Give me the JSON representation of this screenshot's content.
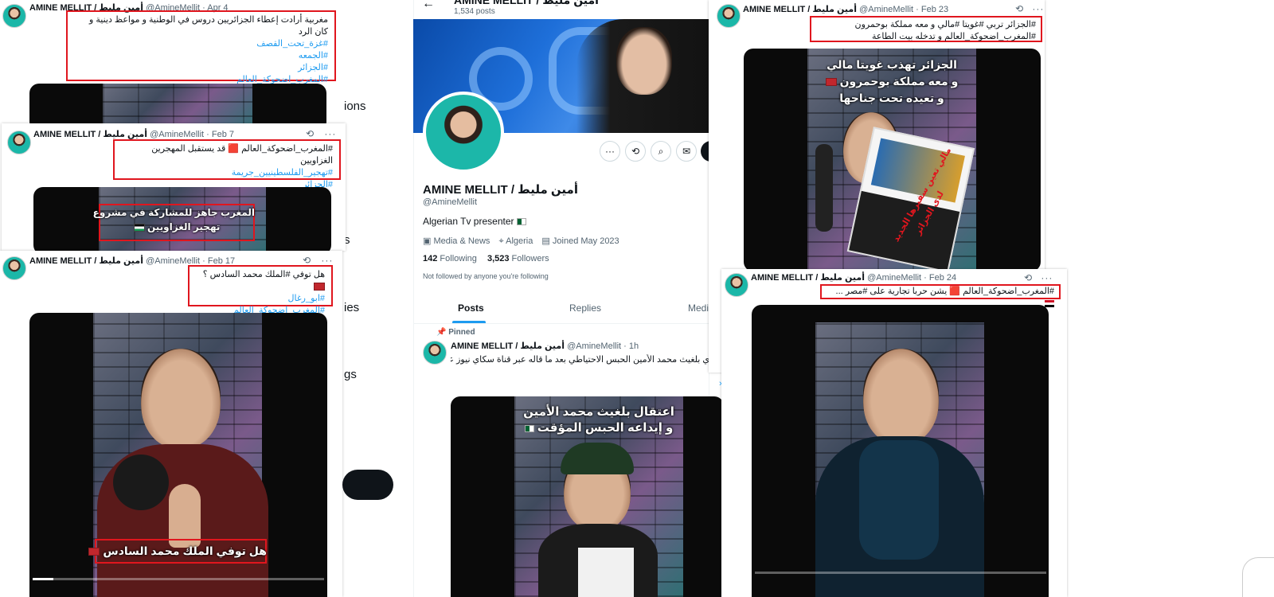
{
  "colors": {
    "accent": "#1d9bf0",
    "highlight": "#e0161e",
    "text": "#0f1419",
    "muted": "#536471"
  },
  "behind": {
    "fragments": [
      "ions",
      "s",
      "ies",
      "gs"
    ]
  },
  "profile": {
    "header_name": "AMINE MELLIT / أمين مليط",
    "posts_count": "1,534 posts",
    "display_name": "AMINE MELLIT / أمين مليط",
    "handle": "@AmineMellit",
    "bio": "Algerian Tv presenter",
    "category": "Media & News",
    "location": "Algeria",
    "joined": "Joined May 2023",
    "following_count": "142",
    "following_label": "Following",
    "followers_count": "3,523",
    "followers_label": "Followers",
    "not_followed_note": "Not followed by anyone you're following",
    "tabs": [
      "Posts",
      "Replies",
      "Medi"
    ],
    "pinned_label": "Pinned",
    "pinned_post": {
      "name": "AMINE MELLIT / أمين مليط",
      "meta": "@AmineMellit · 1h",
      "text": "ي بلغيث محمد الأمين الحبس الاحتياطي بعد ما قاله عبر قناة سكاي نيوز عربية",
      "video_overlay_line1": "اعتقال بلغيث محمد الأمين",
      "video_overlay_line2": "و إيداعه الحبس المؤقت"
    }
  },
  "posts": [
    {
      "name": "AMINE MELLIT / أمين مليط",
      "meta": "@AmineMellit · Apr 4",
      "lines": [
        {
          "text": "مغربية أرادت إعطاء الجزائريين دروس في الوطنية و مواعظ دينية و كان الرد",
          "tag": false
        },
        {
          "text": "#غزة_تحت_القصف",
          "tag": true
        },
        {
          "text": "#الجمعه",
          "tag": true
        },
        {
          "text": "#الجزائر",
          "tag": true
        },
        {
          "text": "#المغرب_اضحوكة_العالم",
          "tag": true
        }
      ]
    },
    {
      "name": "AMINE MELLIT / أمين مليط",
      "meta": "@AmineMellit · Feb 7",
      "lines": [
        {
          "text": "#المغرب_اضحوكة_العالم 🟥 قد يستقبل المهجرين الغزاويين",
          "tag": false
        },
        {
          "text": "#تهجير_الفلسطينيين_جريمة",
          "tag": true
        },
        {
          "text": "#الجزائر",
          "tag": true
        }
      ],
      "overlay_line1": "المغرب جاهز للمشاركة في مشروع",
      "overlay_line2": "تهجير الغزاويين"
    },
    {
      "name": "AMINE MELLIT / أمين مليط",
      "meta": "@AmineMellit · Feb 17",
      "lines": [
        {
          "text": "هل توفي #الملك محمد السادس ؟",
          "tag": false
        },
        {
          "text": "#ابو_رغال",
          "tag": true
        },
        {
          "text": "#المغرب_اضحوكة_العالم",
          "tag": true
        }
      ],
      "overlay": "هل توفي الملك محمد السادس",
      "progress": 0.07
    },
    {
      "name": "AMINE MELLIT / أمين مليط",
      "meta": "@AmineMellit · Feb 23",
      "lines": [
        {
          "text": "#الجزائر تربي #غويتا #مالي و معه مملكة بوحمرون",
          "tag": false
        },
        {
          "text": "#المغرب_اضحوكة_العالم و تدخله بيت الطاعة",
          "tag": false
        }
      ],
      "overlay_line1": "الجزائر تهذب غويتا مالي",
      "overlay_line2": "و معه مملكة بوحمرون",
      "overlay_line3": "و تعيده تحت جناحها",
      "card_line1": "مالي تعين سفيرها الجديد",
      "card_line2": "لدى الجزائر"
    },
    {
      "name": "AMINE MELLIT / أمين مليط",
      "meta": "@AmineMellit · Feb 24",
      "lines": [
        {
          "text": "#المغرب_اضحوكة_العالم 🟥 يشن حربا تجارية على #مصر ...",
          "tag": false
        }
      ]
    }
  ],
  "icons": {
    "back": "←",
    "more": "···",
    "repost": "⟲",
    "search": "⌕",
    "mail": "✉"
  }
}
